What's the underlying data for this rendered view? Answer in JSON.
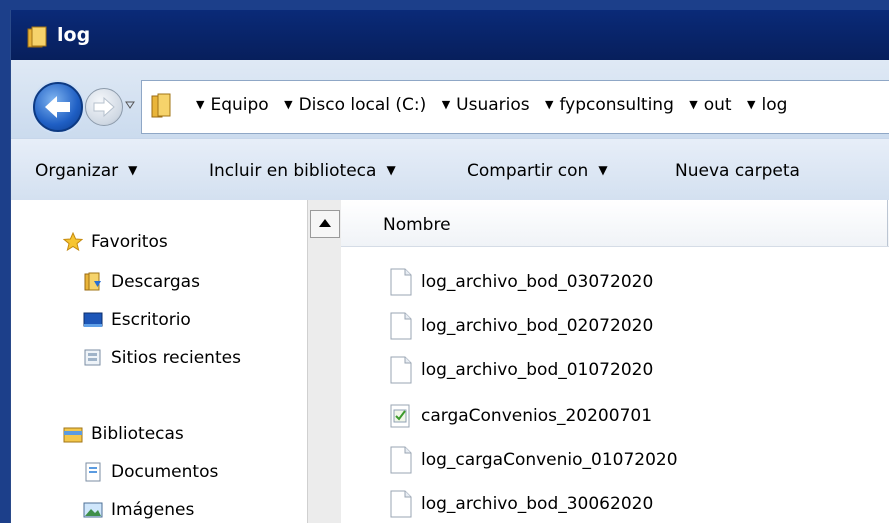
{
  "window": {
    "title": "log"
  },
  "address": {
    "crumbs": [
      "Equipo",
      "Disco local (C:)",
      "Usuarios",
      "fypconsulting",
      "out",
      "log"
    ]
  },
  "toolbar": {
    "organize": "Organizar",
    "include": "Incluir en biblioteca",
    "share": "Compartir con",
    "new_folder": "Nueva carpeta"
  },
  "nav": {
    "favorites": "Favoritos",
    "downloads": "Descargas",
    "desktop": "Escritorio",
    "recent": "Sitios recientes",
    "libraries": "Bibliotecas",
    "documents": "Documentos",
    "images": "Imágenes"
  },
  "columns": {
    "name": "Nombre"
  },
  "files": [
    {
      "name": "log_archivo_bod_03072020",
      "icon": "text-file-icon"
    },
    {
      "name": "log_archivo_bod_02072020",
      "icon": "text-file-icon"
    },
    {
      "name": "log_archivo_bod_01072020",
      "icon": "text-file-icon"
    },
    {
      "name": "cargaConvenios_20200701",
      "icon": "config-file-icon"
    },
    {
      "name": "log_cargaConvenio_01072020",
      "icon": "text-file-icon"
    },
    {
      "name": "log_archivo_bod_30062020",
      "icon": "text-file-icon"
    }
  ]
}
